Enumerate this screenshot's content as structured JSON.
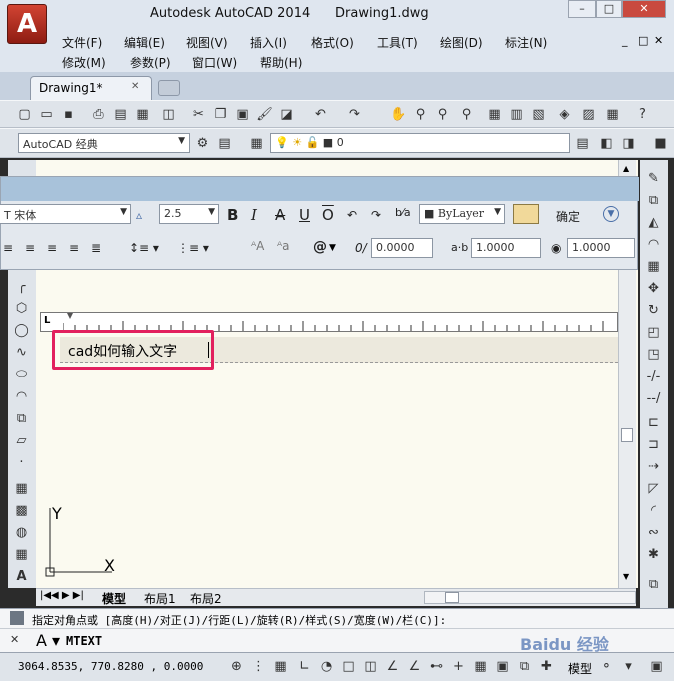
{
  "app": {
    "title": "Autodesk AutoCAD 2014",
    "document": "Drawing1.dwg",
    "logo_letter": "A"
  },
  "window_buttons": {
    "minimize": "–",
    "maximize": "□",
    "close": "✕"
  },
  "doc_buttons": {
    "minimize": "_",
    "restore": "□",
    "close": "✕"
  },
  "menus": {
    "row1": [
      "文件(F)",
      "编辑(E)",
      "视图(V)",
      "插入(I)",
      "格式(O)",
      "工具(T)",
      "绘图(D)",
      "标注(N)"
    ],
    "row2": [
      "修改(M)",
      "参数(P)",
      "窗口(W)",
      "帮助(H)"
    ]
  },
  "tabs": {
    "active": "Drawing1*",
    "close": "✕"
  },
  "workspace": {
    "name": "AutoCAD 经典"
  },
  "layer": {
    "value": "0"
  },
  "text_editor": {
    "font": "宋体",
    "font_prefix": "T",
    "height": "2.5",
    "bold": "B",
    "italic": "I",
    "strike": "A",
    "underline": "U",
    "overline": "O",
    "color": "ByLayer",
    "ok": "确定",
    "oblique": "0.0000",
    "tracking": "1.0000",
    "width_factor": "1.0000",
    "symbol": "@"
  },
  "drawing_text": "cad如何输入文字",
  "ucs": {
    "x": "X",
    "y": "Y"
  },
  "layout_tabs": [
    "模型",
    "布局1",
    "布局2"
  ],
  "command": {
    "prompt": "指定对角点或 [高度(H)/对正(J)/行距(L)/旋转(R)/样式(S)/宽度(W)/栏(C)]:",
    "input": "MTEXT",
    "close": "✕"
  },
  "status": {
    "coords": "3064.8535, 770.8280 , 0.0000",
    "model": "模型"
  },
  "watermark": "Baidu 经验",
  "colors": {
    "highlight": "#e2205e",
    "title_panel": "#a8c2da",
    "canvas": "#fbfaf0"
  }
}
